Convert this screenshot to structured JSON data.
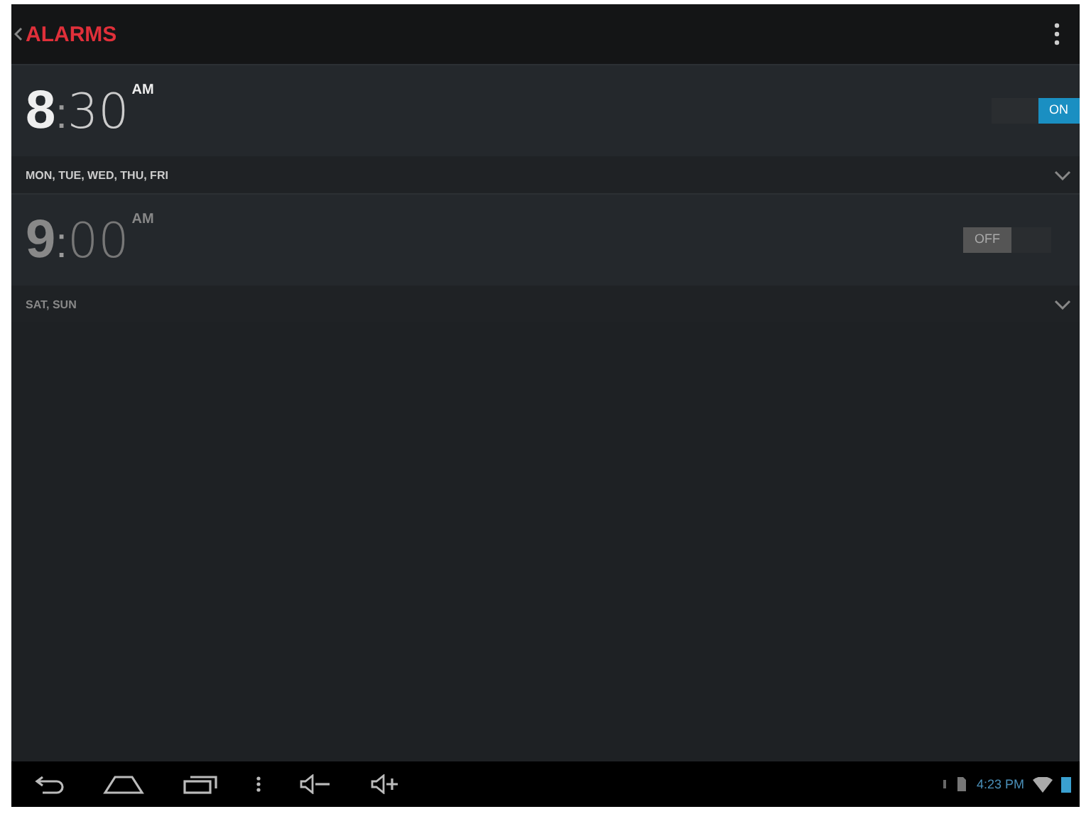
{
  "action_bar": {
    "title": "ALARMS"
  },
  "alarms": [
    {
      "hour": "8",
      "separator": ":",
      "minutes": "30",
      "ampm": "AM",
      "on": true,
      "toggle_label": "ON",
      "days": "MON, TUE, WED, THU, FRI"
    },
    {
      "hour": "9",
      "separator": ":",
      "minutes": "00",
      "ampm": "AM",
      "on": false,
      "toggle_label": "OFF",
      "days": "SAT, SUN"
    }
  ],
  "status_bar": {
    "time": "4:23 PM"
  }
}
